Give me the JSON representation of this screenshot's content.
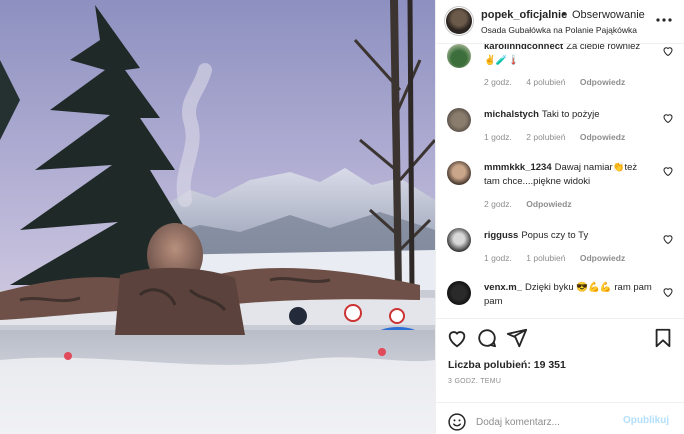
{
  "header": {
    "username": "popek_oficjalnie",
    "separator": "•",
    "follow_label": "Obserwowanie",
    "location": "Osada Gubałówka na Polanie Pająkówka",
    "more_icon": "more-horizontal-icon"
  },
  "comments": [
    {
      "username": "karolinndconnect",
      "text": "Za ciebie również",
      "emoji": "✌️🧪🌡️",
      "age": "2 godz.",
      "likes": "4 polubień",
      "reply": "Odpowiedz"
    },
    {
      "username": "michalstych",
      "text": "Taki to pożyje",
      "age": "1 godz.",
      "likes": "2 polubień",
      "reply": "Odpowiedz"
    },
    {
      "username": "mmmkkk_1234",
      "text": "Dawaj namiar👏też tam chce....piękne widoki",
      "age": "2 godz.",
      "likes": "",
      "reply": "Odpowiedz"
    },
    {
      "username": "rigguss",
      "text": "Popus czy to Ty",
      "age": "1 godz.",
      "likes": "1 polubień",
      "reply": "Odpowiedz"
    },
    {
      "username": "venx.m_",
      "text": "Dzięki byku 😎💪💪 ram pam pam",
      "age": "",
      "likes": "",
      "reply": ""
    }
  ],
  "actions": {
    "like_icon": "heart-icon",
    "comment_icon": "comment-icon",
    "share_icon": "share-icon",
    "save_icon": "bookmark-icon",
    "likes_text": "Liczba polubień: 19 351",
    "time_text": "3 GODZ. TEMU"
  },
  "add_comment": {
    "placeholder": "Dodaj komentarz...",
    "post_label": "Opublikuj",
    "emoji_icon": "smiley-icon"
  },
  "colors": {
    "text": "#262626",
    "muted": "#8e8e8e",
    "border": "#efefef",
    "post_disabled": "#b2dffc"
  }
}
